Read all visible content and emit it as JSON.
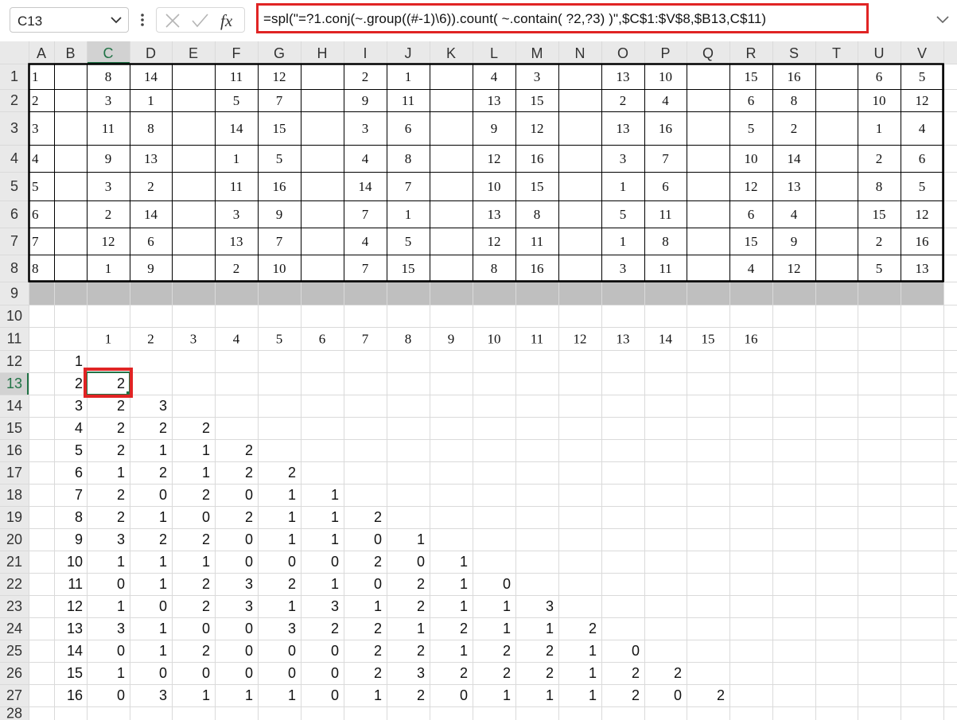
{
  "formula_bar": {
    "name_box": "C13",
    "name_box_dropdown_icon": "chevron-down-icon",
    "more_icon": "vertical-ellipsis-icon",
    "cancel_icon": "x-icon",
    "enter_icon": "checkmark-icon",
    "function_icon_label": "fx",
    "formula": "=spl(\"=?1.conj(~.group((#-1)\\6)).count( ~.contain( ?2,?3) )\",$C$1:$V$8,$B13,C$11)",
    "highlight_color": "#e02424"
  },
  "sheet": {
    "columns": [
      "A",
      "B",
      "C",
      "D",
      "E",
      "F",
      "G",
      "H",
      "I",
      "J",
      "K",
      "L",
      "M",
      "N",
      "O",
      "P",
      "Q",
      "R",
      "S",
      "T",
      "U",
      "V"
    ],
    "rows": [
      "1",
      "2",
      "3",
      "4",
      "5",
      "6",
      "7",
      "8",
      "9",
      "10",
      "11",
      "12",
      "13",
      "14",
      "15",
      "16",
      "17",
      "18",
      "19",
      "20",
      "21",
      "22",
      "23",
      "24",
      "25",
      "26",
      "27",
      "28"
    ],
    "active_column": "C",
    "active_row": "13",
    "active_cell": "C13",
    "header_bg": "#e9e9e9",
    "active_header_bg": "#d2d2d2",
    "active_header_text": "#217346",
    "band_color": "#bfbfbf",
    "top_table": [
      [
        "1",
        "",
        "8",
        "14",
        "",
        "11",
        "12",
        "",
        "2",
        "1",
        "",
        "4",
        "3",
        "",
        "13",
        "10",
        "",
        "15",
        "16",
        "",
        "6",
        "5"
      ],
      [
        "2",
        "",
        "3",
        "1",
        "",
        "5",
        "7",
        "",
        "9",
        "11",
        "",
        "13",
        "15",
        "",
        "2",
        "4",
        "",
        "6",
        "8",
        "",
        "10",
        "12"
      ],
      [
        "3",
        "",
        "11",
        "8",
        "",
        "14",
        "15",
        "",
        "3",
        "6",
        "",
        "9",
        "12",
        "",
        "13",
        "16",
        "",
        "5",
        "2",
        "",
        "1",
        "4"
      ],
      [
        "4",
        "",
        "9",
        "13",
        "",
        "1",
        "5",
        "",
        "4",
        "8",
        "",
        "12",
        "16",
        "",
        "3",
        "7",
        "",
        "10",
        "14",
        "",
        "2",
        "6"
      ],
      [
        "5",
        "",
        "3",
        "2",
        "",
        "11",
        "16",
        "",
        "14",
        "7",
        "",
        "10",
        "15",
        "",
        "1",
        "6",
        "",
        "12",
        "13",
        "",
        "8",
        "5"
      ],
      [
        "6",
        "",
        "2",
        "14",
        "",
        "3",
        "9",
        "",
        "7",
        "1",
        "",
        "13",
        "8",
        "",
        "5",
        "11",
        "",
        "6",
        "4",
        "",
        "15",
        "12"
      ],
      [
        "7",
        "",
        "12",
        "6",
        "",
        "13",
        "7",
        "",
        "4",
        "5",
        "",
        "12",
        "11",
        "",
        "1",
        "8",
        "",
        "15",
        "9",
        "",
        "2",
        "16"
      ],
      [
        "8",
        "",
        "1",
        "9",
        "",
        "2",
        "10",
        "",
        "7",
        "15",
        "",
        "8",
        "16",
        "",
        "3",
        "11",
        "",
        "4",
        "12",
        "",
        "5",
        "13"
      ]
    ],
    "header_numbers": [
      "1",
      "2",
      "3",
      "4",
      "5",
      "6",
      "7",
      "8",
      "9",
      "10",
      "11",
      "12",
      "13",
      "14",
      "15",
      "16"
    ],
    "result_rows": [
      {
        "b": "1",
        "values": []
      },
      {
        "b": "2",
        "values": [
          "2"
        ]
      },
      {
        "b": "3",
        "values": [
          "2",
          "3"
        ]
      },
      {
        "b": "4",
        "values": [
          "2",
          "2",
          "2"
        ]
      },
      {
        "b": "5",
        "values": [
          "2",
          "1",
          "1",
          "2"
        ]
      },
      {
        "b": "6",
        "values": [
          "1",
          "2",
          "1",
          "2",
          "2"
        ]
      },
      {
        "b": "7",
        "values": [
          "2",
          "0",
          "2",
          "0",
          "1",
          "1"
        ]
      },
      {
        "b": "8",
        "values": [
          "2",
          "1",
          "0",
          "2",
          "1",
          "1",
          "2"
        ]
      },
      {
        "b": "9",
        "values": [
          "3",
          "2",
          "2",
          "0",
          "1",
          "1",
          "0",
          "1"
        ]
      },
      {
        "b": "10",
        "values": [
          "1",
          "1",
          "1",
          "0",
          "0",
          "0",
          "2",
          "0",
          "1"
        ]
      },
      {
        "b": "11",
        "values": [
          "0",
          "1",
          "2",
          "3",
          "2",
          "1",
          "0",
          "2",
          "1",
          "0"
        ]
      },
      {
        "b": "12",
        "values": [
          "1",
          "0",
          "2",
          "3",
          "1",
          "3",
          "1",
          "2",
          "1",
          "1",
          "3"
        ]
      },
      {
        "b": "13",
        "values": [
          "3",
          "1",
          "0",
          "0",
          "3",
          "2",
          "2",
          "1",
          "2",
          "1",
          "1",
          "2"
        ]
      },
      {
        "b": "14",
        "values": [
          "0",
          "1",
          "2",
          "0",
          "0",
          "0",
          "2",
          "2",
          "1",
          "2",
          "2",
          "1",
          "0"
        ]
      },
      {
        "b": "15",
        "values": [
          "1",
          "0",
          "0",
          "0",
          "0",
          "0",
          "2",
          "3",
          "2",
          "2",
          "2",
          "1",
          "2",
          "2"
        ]
      },
      {
        "b": "16",
        "values": [
          "0",
          "3",
          "1",
          "1",
          "1",
          "0",
          "1",
          "2",
          "0",
          "1",
          "1",
          "1",
          "2",
          "0",
          "2"
        ]
      }
    ]
  }
}
